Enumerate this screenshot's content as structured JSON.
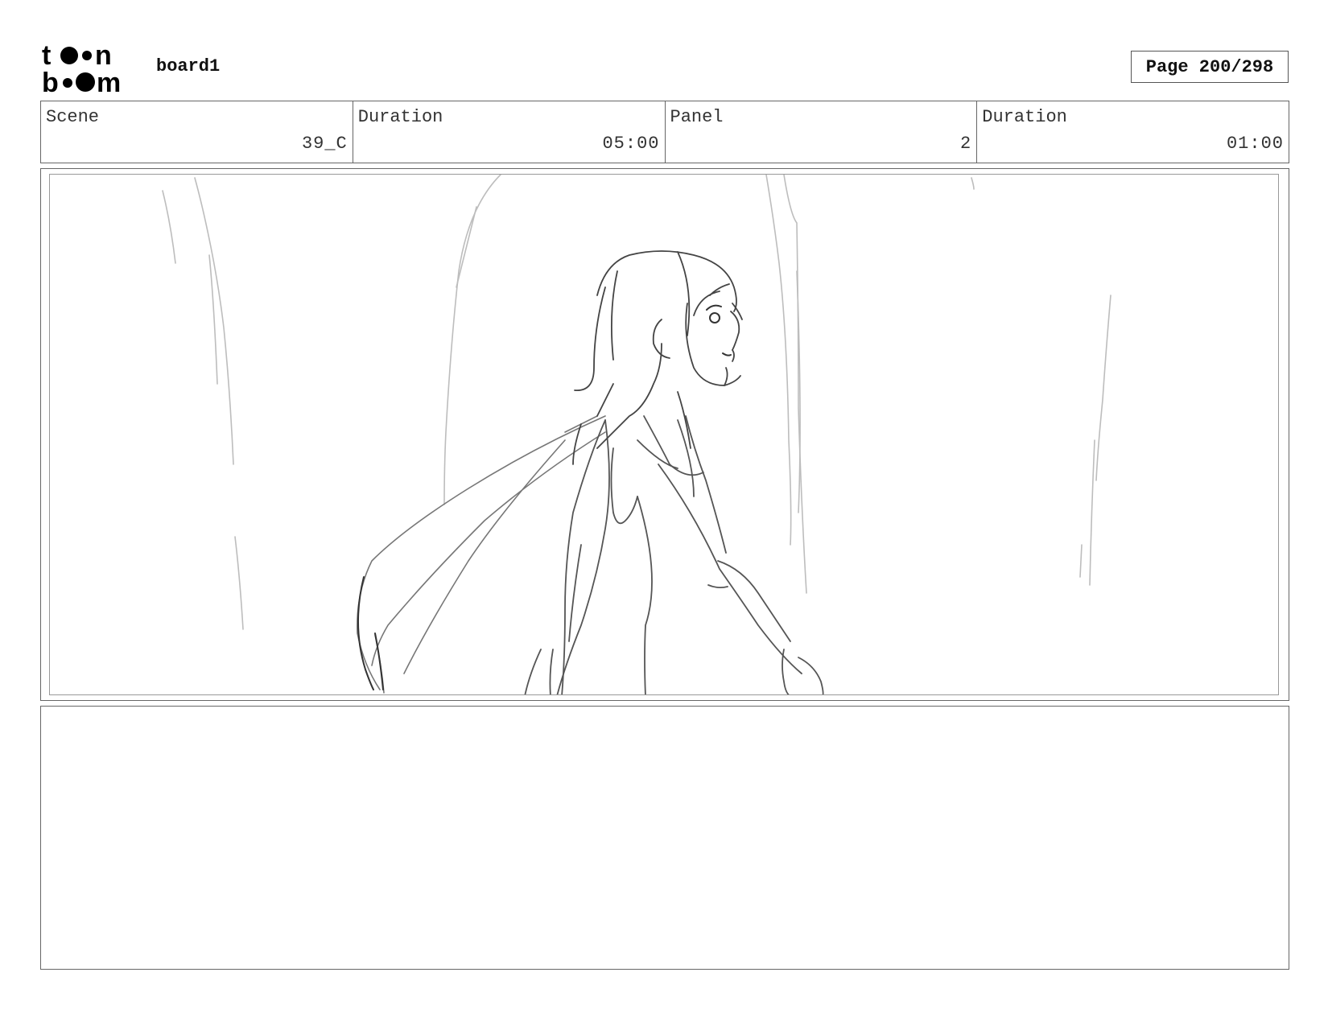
{
  "header": {
    "logo_text": "toon boom",
    "project_title": "board1",
    "page_label": "Page 200/298"
  },
  "info": {
    "scene_label": "Scene",
    "scene_value": "39_C",
    "scene_duration_label": "Duration",
    "scene_duration_value": "05:00",
    "panel_label": "Panel",
    "panel_value": "2",
    "panel_duration_label": "Duration",
    "panel_duration_value": "01:00"
  },
  "panel": {
    "drawing": "girl-walking-sketch"
  },
  "notes": {
    "text": ""
  }
}
